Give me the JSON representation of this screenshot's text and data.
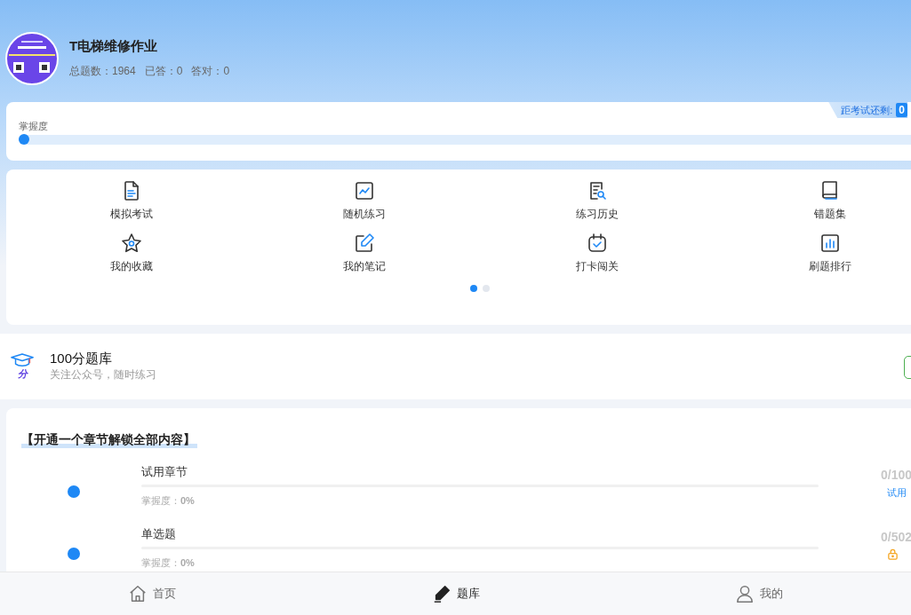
{
  "header": {
    "title": "T电梯维修作业",
    "stats": [
      "总题数：1964",
      "已答：0",
      "答对：0"
    ]
  },
  "mastery": {
    "label": "掌握度",
    "level": 0,
    "countdown_label": "距考试还剩:",
    "countdown_value": "0"
  },
  "menu": [
    {
      "label": "模拟考试"
    },
    {
      "label": "随机练习"
    },
    {
      "label": "练习历史"
    },
    {
      "label": "错题集"
    },
    {
      "label": "我的收藏"
    },
    {
      "label": "我的笔记"
    },
    {
      "label": "打卡闯关"
    },
    {
      "label": "刷题排行"
    }
  ],
  "pager": [
    {
      "selected": true
    },
    {
      "selected": false
    }
  ],
  "promo": {
    "logo_text": "分",
    "title": "100分题库",
    "subtitle": "关注公众号，随时练习"
  },
  "chapters": {
    "heading": "【开通一个章节解锁全部内容】",
    "items": [
      {
        "title": "试用章节",
        "level": 0,
        "mastery": "掌握度：**0%**",
        "count": "0/100",
        "kind": "trial",
        "tag": "试用"
      },
      {
        "title": "单选题",
        "level": 0,
        "mastery": "掌握度：**0%**",
        "count": "0/502",
        "kind": "locked"
      }
    ]
  },
  "tabbar": [
    {
      "label": "首页",
      "selected": false
    },
    {
      "label": "题库",
      "selected": true
    },
    {
      "label": "我的",
      "selected": false
    }
  ]
}
